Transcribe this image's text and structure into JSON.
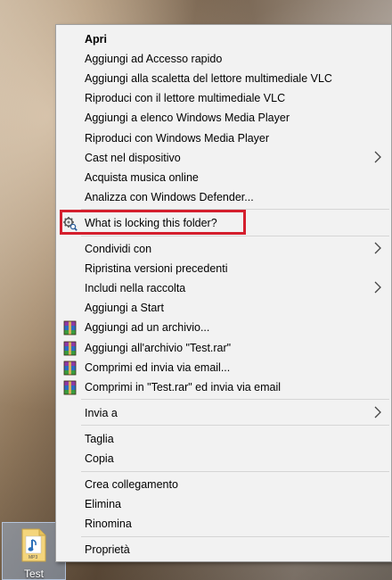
{
  "desktop": {
    "file_label": "Test",
    "file_badge": "MP3"
  },
  "context_menu": {
    "groups": [
      {
        "items": [
          {
            "label": "Apri",
            "bold": true
          },
          {
            "label": "Aggiungi ad Accesso rapido"
          },
          {
            "label": "Aggiungi alla scaletta del lettore multimediale VLC"
          },
          {
            "label": "Riproduci con il lettore multimediale VLC"
          },
          {
            "label": "Aggiungi a elenco Windows Media Player"
          },
          {
            "label": "Riproduci con Windows Media Player"
          },
          {
            "label": "Cast nel dispositivo",
            "submenu": true
          },
          {
            "label": "Acquista musica online"
          },
          {
            "label": "Analizza con Windows Defender..."
          }
        ]
      },
      {
        "items": [
          {
            "label": "What is locking this folder?",
            "icon": "gear-magnifier-icon",
            "highlighted": true
          }
        ]
      },
      {
        "items": [
          {
            "label": "Condividi con",
            "submenu": true
          },
          {
            "label": "Ripristina versioni precedenti"
          },
          {
            "label": "Includi nella raccolta",
            "submenu": true
          },
          {
            "label": "Aggiungi a Start"
          },
          {
            "label": "Aggiungi ad un archivio...",
            "icon": "winrar-icon"
          },
          {
            "label": "Aggiungi all'archivio \"Test.rar\"",
            "icon": "winrar-icon"
          },
          {
            "label": "Comprimi ed invia via email...",
            "icon": "winrar-icon"
          },
          {
            "label": "Comprimi in \"Test.rar\" ed invia via email",
            "icon": "winrar-icon"
          }
        ]
      },
      {
        "items": [
          {
            "label": "Invia a",
            "submenu": true
          }
        ]
      },
      {
        "items": [
          {
            "label": "Taglia"
          },
          {
            "label": "Copia"
          }
        ]
      },
      {
        "items": [
          {
            "label": "Crea collegamento"
          },
          {
            "label": "Elimina"
          },
          {
            "label": "Rinomina"
          }
        ]
      },
      {
        "items": [
          {
            "label": "Proprietà"
          }
        ]
      }
    ]
  },
  "colors": {
    "menu_background": "#f2f2f2",
    "highlight_border": "#d41e2d",
    "separator": "#d5d5d5"
  }
}
